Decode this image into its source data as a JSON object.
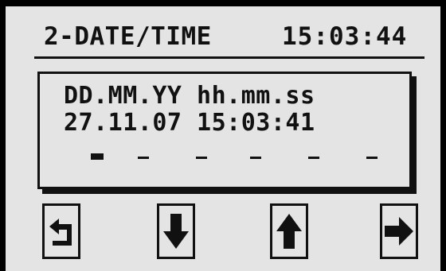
{
  "header": {
    "screen_title": "2-DATE/TIME",
    "current_time": "15:03:44"
  },
  "editor": {
    "format_label": "DD.MM.YY hh.mm.ss",
    "value": "27.11.07 15:03:41",
    "active_field": "day"
  },
  "softkeys": [
    {
      "icon": "back-arrow-icon"
    },
    {
      "icon": "down-arrow-icon"
    },
    {
      "icon": "up-arrow-icon"
    },
    {
      "icon": "right-arrow-icon"
    }
  ],
  "colors": {
    "screen_background": "#e4e4e4",
    "foreground": "#111111",
    "bezel": "#000000"
  }
}
